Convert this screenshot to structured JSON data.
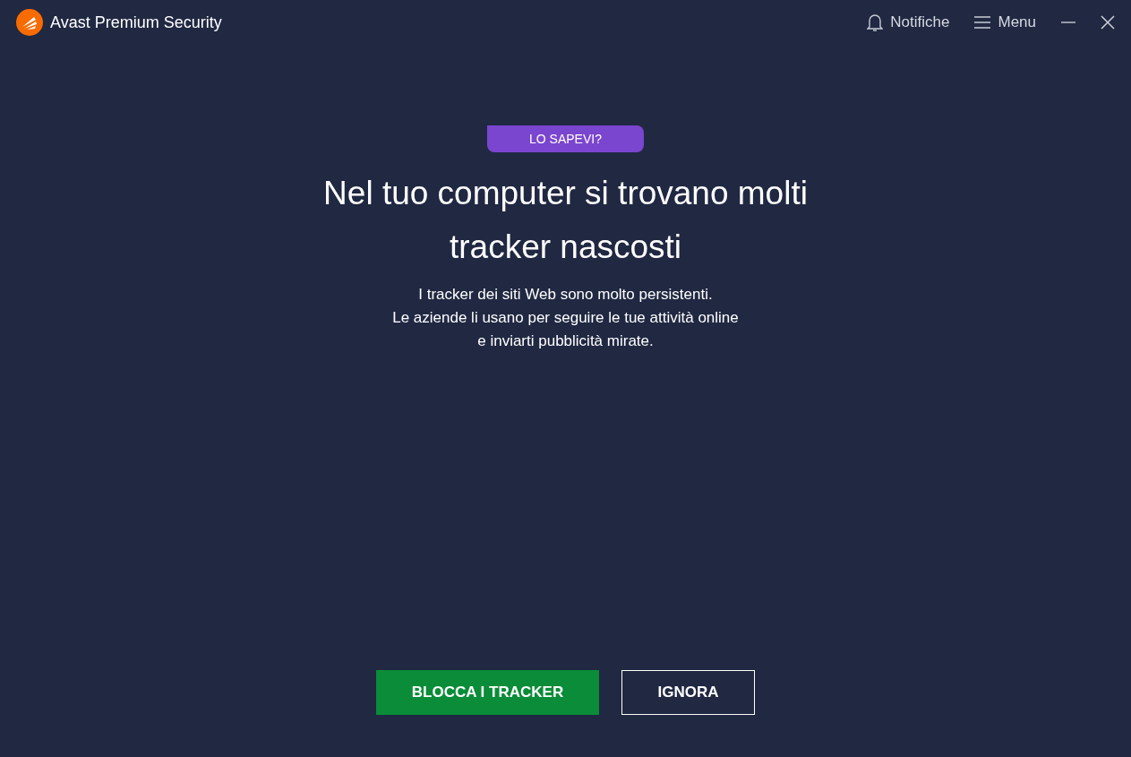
{
  "window": {
    "title": "Avast Premium Security",
    "actions": [
      {
        "kind": "bell",
        "label": "Notifiche"
      },
      {
        "kind": "menu",
        "label": "Menu"
      }
    ]
  },
  "prompt": {
    "badge": "LO SAPEVI?",
    "heading": "Nel tuo computer si trovano molti tracker nascosti",
    "body": [
      "I tracker dei siti Web sono molto persistenti.",
      "Le aziende li usano per seguire le tue attività online",
      "e inviarti pubblicità mirate."
    ]
  },
  "buttons": [
    {
      "kind": "primary",
      "label": "BLOCCA I TRACKER"
    },
    {
      "kind": "secondary",
      "label": "IGNORA"
    }
  ]
}
